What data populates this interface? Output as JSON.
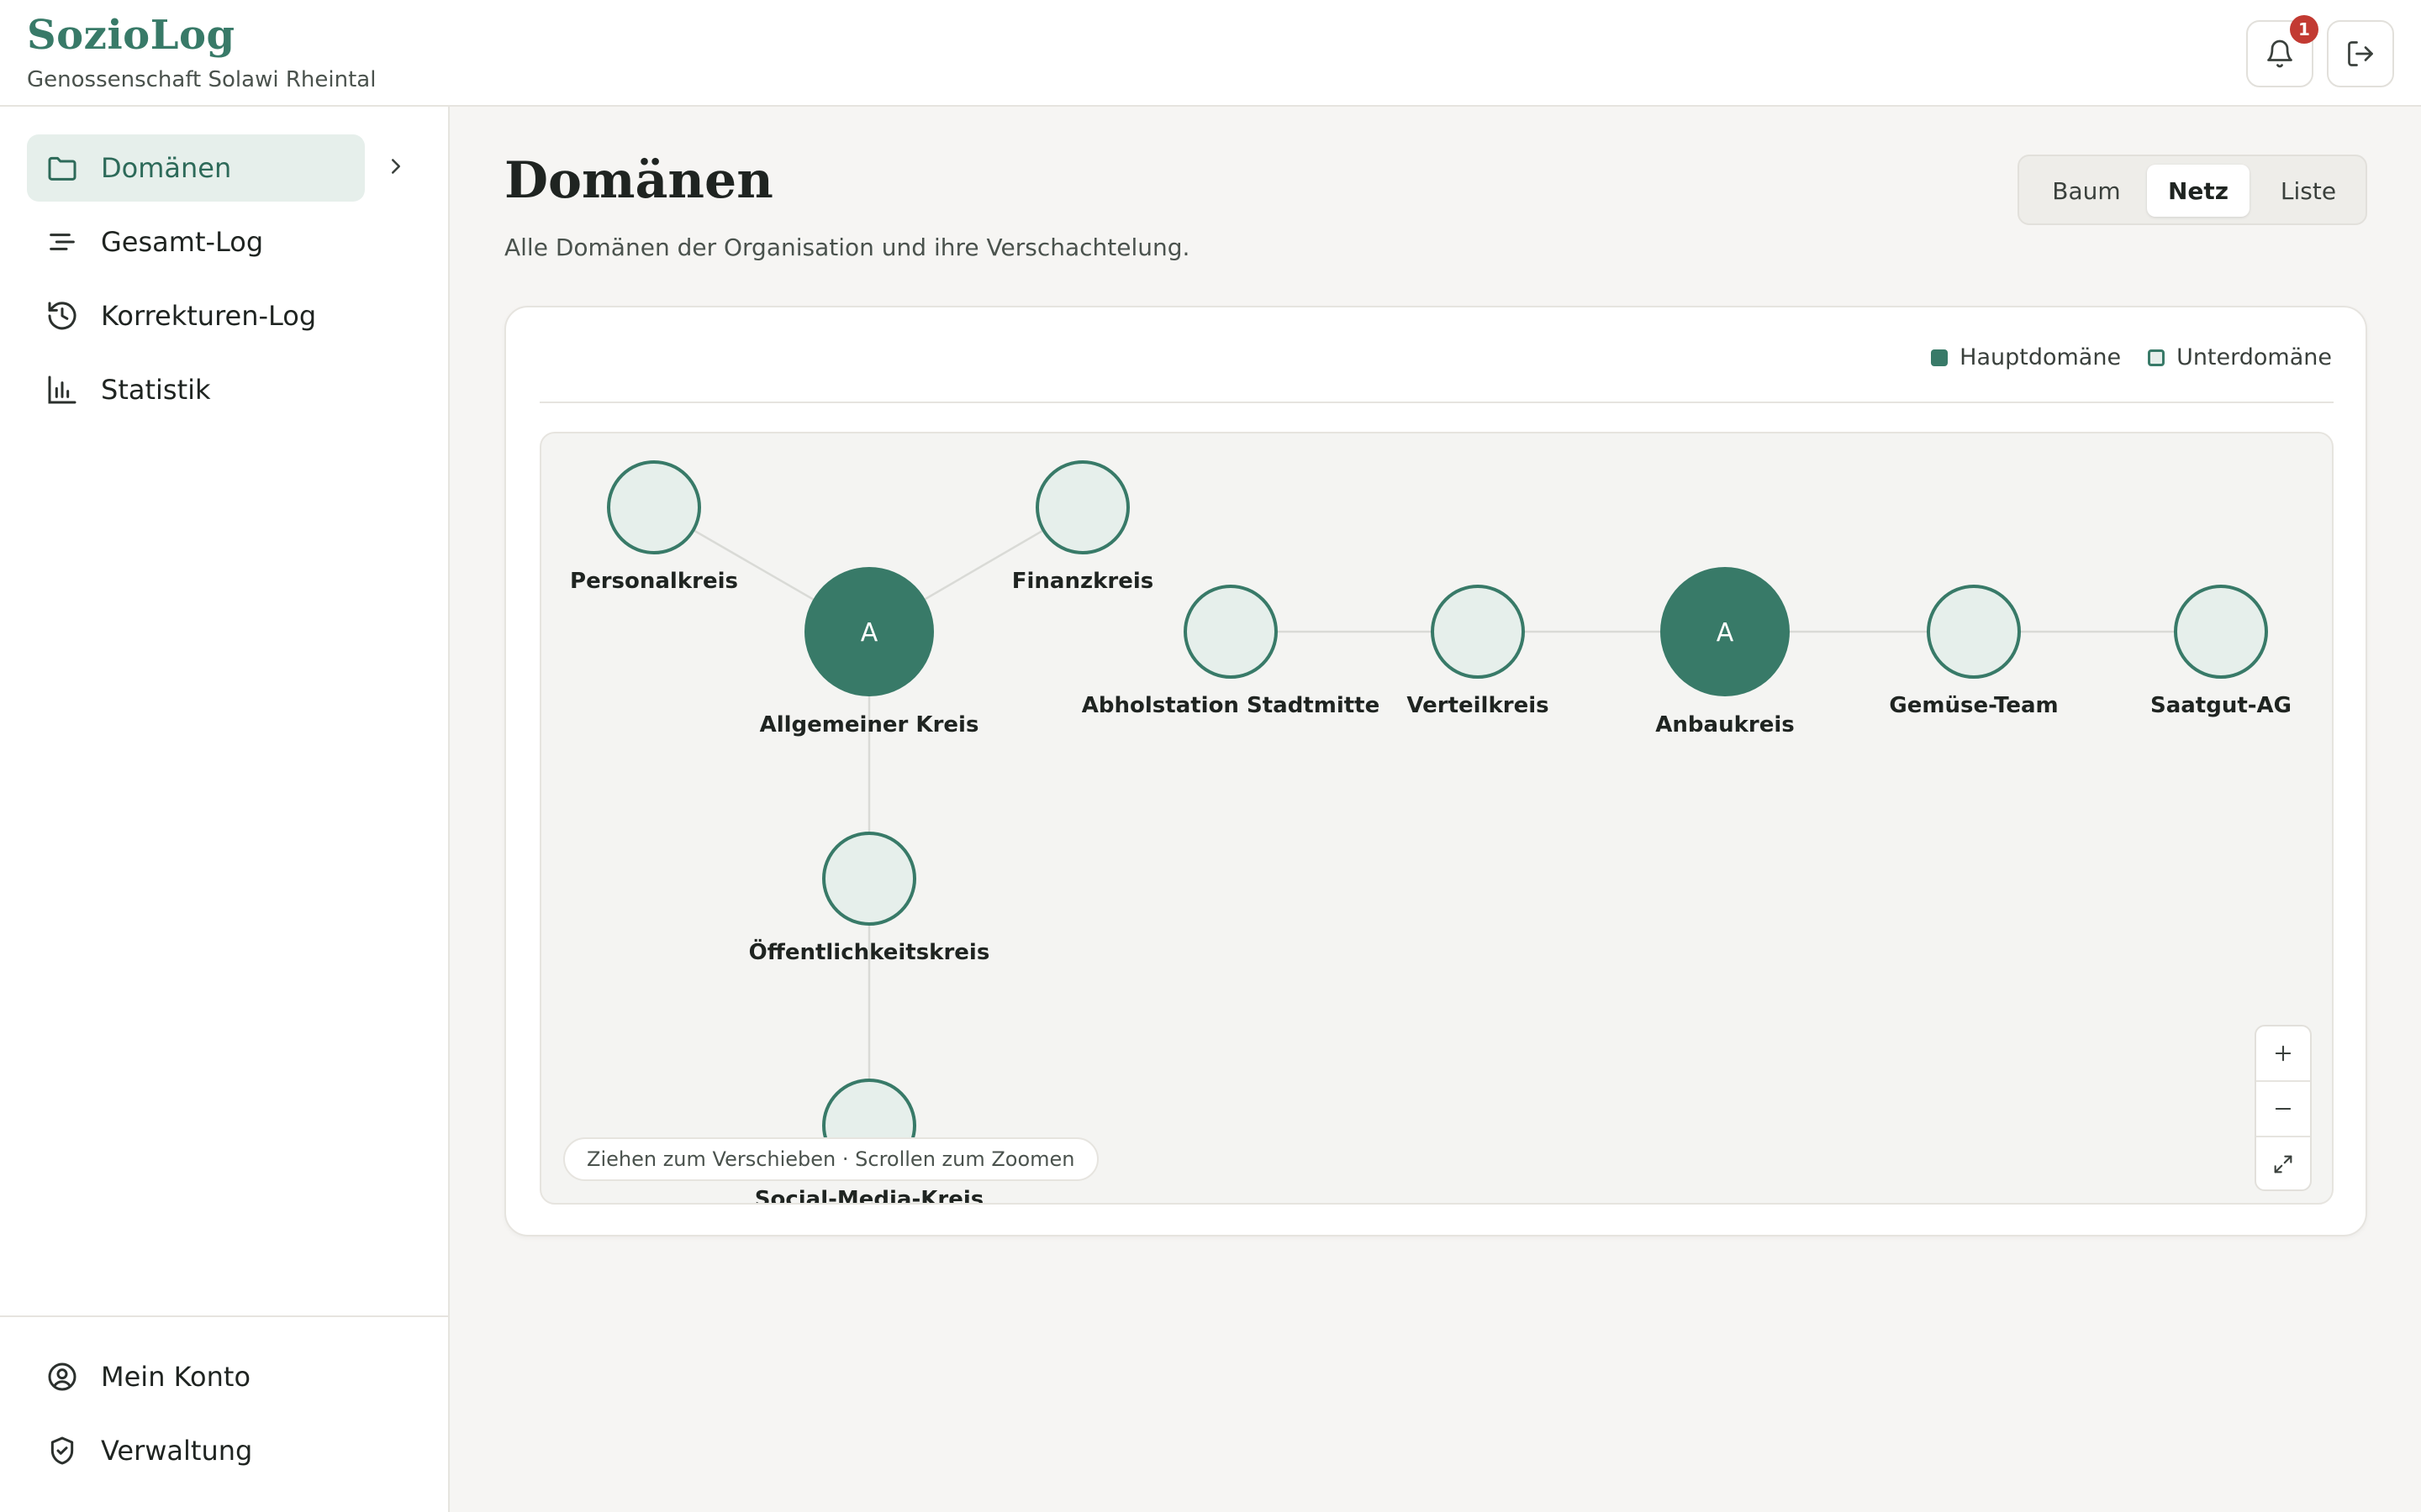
{
  "app": {
    "name": "SozioLog",
    "organization": "Genossenschaft Solawi Rheintal",
    "notification_count": "1"
  },
  "sidebar": {
    "items": [
      {
        "label": "Domänen",
        "icon": "folder-icon",
        "active": true
      },
      {
        "label": "Gesamt-Log",
        "icon": "list-lines-icon"
      },
      {
        "label": "Korrekturen-Log",
        "icon": "history-icon"
      },
      {
        "label": "Statistik",
        "icon": "bar-chart-icon"
      }
    ],
    "bottom_items": [
      {
        "label": "Mein Konto",
        "icon": "user-circle-icon"
      },
      {
        "label": "Verwaltung",
        "icon": "shield-check-icon"
      }
    ]
  },
  "page": {
    "title": "Domänen",
    "subtitle": "Alle Domänen der Organisation und ihre Verschachtelung."
  },
  "view_switch": {
    "options": [
      "Baum",
      "Netz",
      "Liste"
    ],
    "selected": "Netz"
  },
  "legend": {
    "main": "Hauptdomäne",
    "sub": "Unterdomäne"
  },
  "graph": {
    "nodes": [
      {
        "id": "personalkreis",
        "label": "Personalkreis",
        "type": "sub"
      },
      {
        "id": "allgemeiner-kreis",
        "label": "Allgemeiner Kreis",
        "type": "main",
        "letter": "A"
      },
      {
        "id": "finanzkreis",
        "label": "Finanzkreis",
        "type": "sub"
      },
      {
        "id": "oeffentlichkeitskreis",
        "label": "Öffentlichkeitskreis",
        "type": "sub"
      },
      {
        "id": "social-media-kreis",
        "label": "Social-Media-Kreis",
        "type": "sub"
      },
      {
        "id": "abholstation-stadtmitte",
        "label": "Abholstation Stadtmitte",
        "type": "sub"
      },
      {
        "id": "verteilkreis",
        "label": "Verteilkreis",
        "type": "sub"
      },
      {
        "id": "anbaukreis",
        "label": "Anbaukreis",
        "type": "main",
        "letter": "A"
      },
      {
        "id": "gemuese-team",
        "label": "Gemüse-Team",
        "type": "sub"
      },
      {
        "id": "saatgut-ag",
        "label": "Saatgut-AG",
        "type": "sub"
      }
    ],
    "edges": [
      [
        "personalkreis",
        "allgemeiner-kreis"
      ],
      [
        "finanzkreis",
        "allgemeiner-kreis"
      ],
      [
        "allgemeiner-kreis",
        "oeffentlichkeitskreis"
      ],
      [
        "oeffentlichkeitskreis",
        "social-media-kreis"
      ],
      [
        "abholstation-stadtmitte",
        "verteilkreis"
      ],
      [
        "verteilkreis",
        "anbaukreis"
      ],
      [
        "anbaukreis",
        "gemuese-team"
      ],
      [
        "gemuese-team",
        "saatgut-ag"
      ]
    ],
    "hint": "Ziehen zum Verschieben · Scrollen zum Zoomen"
  },
  "colors": {
    "brand": "#387a68",
    "main_node_fill": "#387a68",
    "sub_node_fill": "#e6efeb",
    "edge": "#d9dad6",
    "badge": "#c23a32"
  }
}
